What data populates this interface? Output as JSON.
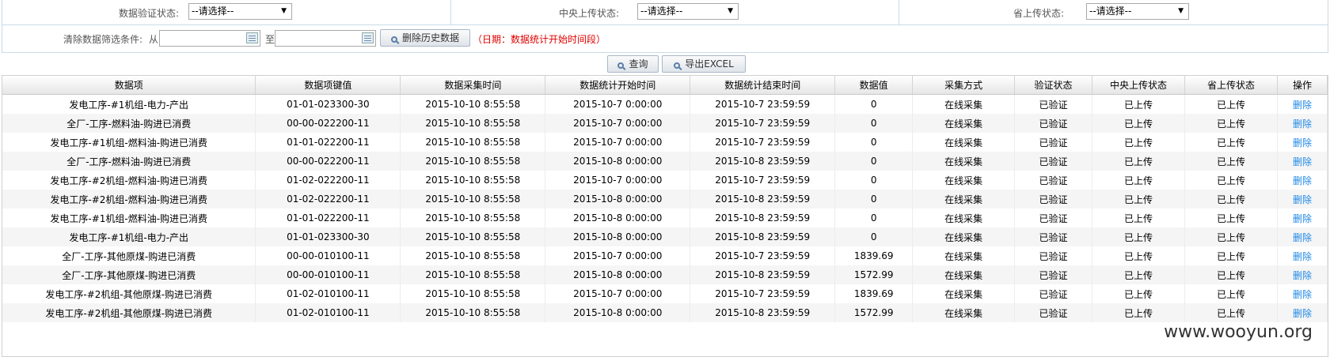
{
  "filters": {
    "verify_label": "数据验证状态:",
    "central_label": "中央上传状态:",
    "province_label": "省上传状态:",
    "select_value": "--请选择--",
    "clear_label": "清除数据筛选条件:",
    "from_label": "从",
    "to_label": "至",
    "from_value": "",
    "to_value": "",
    "delete_history_button": "删除历史数据",
    "date_hint": "（日期：数据统计开始时间段）"
  },
  "actions": {
    "query_button": "查询",
    "export_button": "导出EXCEL"
  },
  "table": {
    "columns": [
      "数据项",
      "数据项键值",
      "数据采集时间",
      "数据统计开始时间",
      "数据统计结束时间",
      "数据值",
      "采集方式",
      "验证状态",
      "中央上传状态",
      "省上传状态",
      "操作"
    ],
    "rows": [
      [
        "发电工序-#1机组-电力-产出",
        "01-01-023300-30",
        "2015-10-10 8:55:58",
        "2015-10-7 0:00:00",
        "2015-10-7 23:59:59",
        "0",
        "在线采集",
        "已验证",
        "已上传",
        "已上传",
        "删除"
      ],
      [
        "全厂-工序-燃料油-购进已消费",
        "00-00-022200-11",
        "2015-10-10 8:55:58",
        "2015-10-7 0:00:00",
        "2015-10-7 23:59:59",
        "0",
        "在线采集",
        "已验证",
        "已上传",
        "已上传",
        "删除"
      ],
      [
        "发电工序-#1机组-燃料油-购进已消费",
        "01-01-022200-11",
        "2015-10-10 8:55:58",
        "2015-10-7 0:00:00",
        "2015-10-7 23:59:59",
        "0",
        "在线采集",
        "已验证",
        "已上传",
        "已上传",
        "删除"
      ],
      [
        "全厂-工序-燃料油-购进已消费",
        "00-00-022200-11",
        "2015-10-10 8:55:58",
        "2015-10-8 0:00:00",
        "2015-10-8 23:59:59",
        "0",
        "在线采集",
        "已验证",
        "已上传",
        "已上传",
        "删除"
      ],
      [
        "发电工序-#2机组-燃料油-购进已消费",
        "01-02-022200-11",
        "2015-10-10 8:55:58",
        "2015-10-7 0:00:00",
        "2015-10-7 23:59:59",
        "0",
        "在线采集",
        "已验证",
        "已上传",
        "已上传",
        "删除"
      ],
      [
        "发电工序-#2机组-燃料油-购进已消费",
        "01-02-022200-11",
        "2015-10-10 8:55:58",
        "2015-10-8 0:00:00",
        "2015-10-8 23:59:59",
        "0",
        "在线采集",
        "已验证",
        "已上传",
        "已上传",
        "删除"
      ],
      [
        "发电工序-#1机组-燃料油-购进已消费",
        "01-01-022200-11",
        "2015-10-10 8:55:58",
        "2015-10-8 0:00:00",
        "2015-10-8 23:59:59",
        "0",
        "在线采集",
        "已验证",
        "已上传",
        "已上传",
        "删除"
      ],
      [
        "发电工序-#1机组-电力-产出",
        "01-01-023300-30",
        "2015-10-10 8:55:58",
        "2015-10-8 0:00:00",
        "2015-10-8 23:59:59",
        "0",
        "在线采集",
        "已验证",
        "已上传",
        "已上传",
        "删除"
      ],
      [
        "全厂-工序-其他原煤-购进已消费",
        "00-00-010100-11",
        "2015-10-10 8:55:58",
        "2015-10-7 0:00:00",
        "2015-10-7 23:59:59",
        "1839.69",
        "在线采集",
        "已验证",
        "已上传",
        "已上传",
        "删除"
      ],
      [
        "全厂-工序-其他原煤-购进已消费",
        "00-00-010100-11",
        "2015-10-10 8:55:58",
        "2015-10-8 0:00:00",
        "2015-10-8 23:59:59",
        "1572.99",
        "在线采集",
        "已验证",
        "已上传",
        "已上传",
        "删除"
      ],
      [
        "发电工序-#2机组-其他原煤-购进已消费",
        "01-02-010100-11",
        "2015-10-10 8:55:58",
        "2015-10-7 0:00:00",
        "2015-10-7 23:59:59",
        "1839.69",
        "在线采集",
        "已验证",
        "已上传",
        "已上传",
        "删除"
      ],
      [
        "发电工序-#2机组-其他原煤-购进已消费",
        "01-02-010100-11",
        "2015-10-10 8:55:58",
        "2015-10-8 0:00:00",
        "2015-10-8 23:59:59",
        "1572.99",
        "在线采集",
        "已验证",
        "已上传",
        "已上传",
        "删除"
      ]
    ]
  },
  "watermark": "www.wooyun.org",
  "colors": {
    "border": "#c8dbe8",
    "hint_red": "#e00000",
    "link_blue": "#1e88e5"
  }
}
